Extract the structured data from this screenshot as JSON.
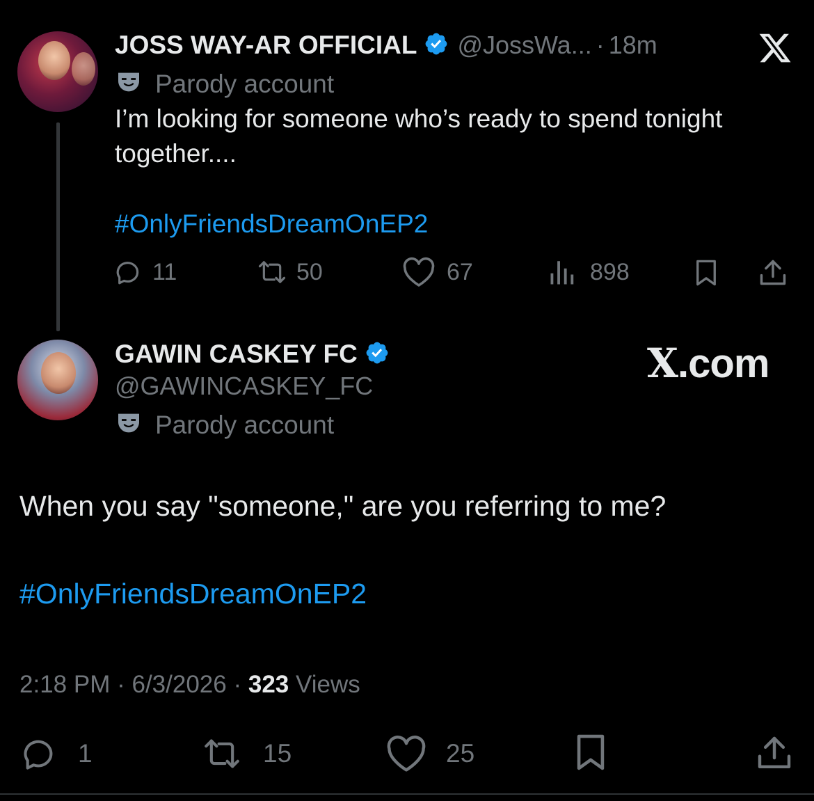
{
  "tweet1": {
    "display_name": "JOSS WAY-AR OFFICIAL",
    "handle": "@JossWa...",
    "separator": "·",
    "time_ago": "18m",
    "parody_label": "Parody account",
    "text": "I’m looking for someone who’s ready to spend tonight together....",
    "hashtag": "#OnlyFriendsDreamOnEP2",
    "replies": "11",
    "reposts": "50",
    "likes": "67",
    "views": "898"
  },
  "tweet2": {
    "display_name": "GAWIN CASKEY FC",
    "handle": "@GAWINCASKEY_FC",
    "parody_label": "Parody account",
    "text": "When you say \"someone,\" are you referring to me?",
    "hashtag": "#OnlyFriendsDreamOnEP2",
    "timestamp_time": "2:18 PM",
    "timestamp_sep1": "·",
    "timestamp_date": "6/3/2026",
    "timestamp_sep2": "·",
    "views_count": "323",
    "views_label": "Views",
    "replies": "1",
    "reposts": "15",
    "likes": "25"
  },
  "watermark": {
    "x_letter": "X",
    "suffix": ".com"
  },
  "colors": {
    "accent": "#1d9bf0",
    "text": "#e7e9ea",
    "muted": "#71767b",
    "background": "#000000"
  },
  "icons": [
    "x-logo-icon",
    "verified-badge-icon",
    "parody-mask-icon",
    "reply-icon",
    "repost-icon",
    "like-icon",
    "views-icon",
    "bookmark-icon",
    "share-icon"
  ]
}
